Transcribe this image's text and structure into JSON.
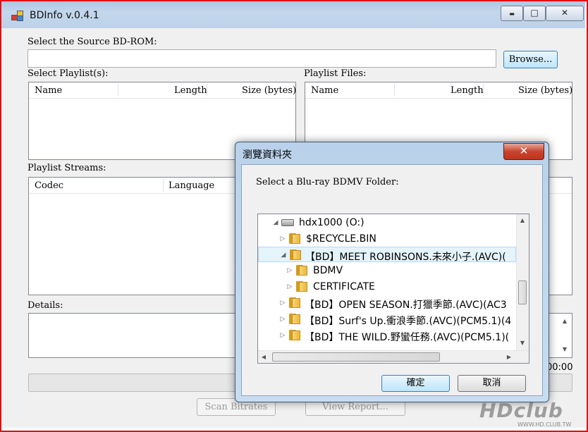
{
  "window": {
    "title": "BDInfo v.0.4.1",
    "controls": {
      "minimize": "▬",
      "maximize": "□",
      "close": "✕"
    }
  },
  "source": {
    "label": "Select the Source BD-ROM:",
    "value": "",
    "browse_label": "Browse..."
  },
  "playlists": {
    "label": "Select Playlist(s):",
    "columns": [
      "Name",
      "Length",
      "Size (bytes)"
    ]
  },
  "playlist_files": {
    "label": "Playlist Files:",
    "columns": [
      "Name",
      "Length",
      "Size (bytes)"
    ]
  },
  "streams": {
    "label": "Playlist Streams:",
    "columns": [
      "Codec",
      "Language"
    ]
  },
  "details": {
    "label": "Details:",
    "time": "00:00"
  },
  "buttons": {
    "scan": "Scan Bitrates",
    "view_report": "View Report..."
  },
  "dialog": {
    "title": "瀏覽資料夾",
    "prompt": "Select a Blu-ray BDMV Folder:",
    "ok_label": "確定",
    "cancel_label": "取消",
    "tree": [
      {
        "label": "hdx1000 (O:)",
        "type": "drive",
        "expanded": true
      },
      {
        "label": "$RECYCLE.BIN",
        "type": "folder",
        "expanded": false
      },
      {
        "label": "【BD】MEET ROBINSONS.未來小子.(AVC)(",
        "type": "folder",
        "expanded": true,
        "selected": true
      },
      {
        "label": "BDMV",
        "type": "folder",
        "expanded": false
      },
      {
        "label": "CERTIFICATE",
        "type": "folder",
        "expanded": false
      },
      {
        "label": "【BD】OPEN SEASON.打獵季節.(AVC)(AC3",
        "type": "folder",
        "expanded": false
      },
      {
        "label": "【BD】Surf's Up.衝浪季節.(AVC)(PCM5.1)(4",
        "type": "folder",
        "expanded": false
      },
      {
        "label": "【BD】THE WILD.野蠻任務.(AVC)(PCM5.1)(",
        "type": "folder",
        "expanded": false
      }
    ]
  },
  "watermark": {
    "text": "HDclub",
    "url": "WWW.HD.CLUB.TW"
  }
}
